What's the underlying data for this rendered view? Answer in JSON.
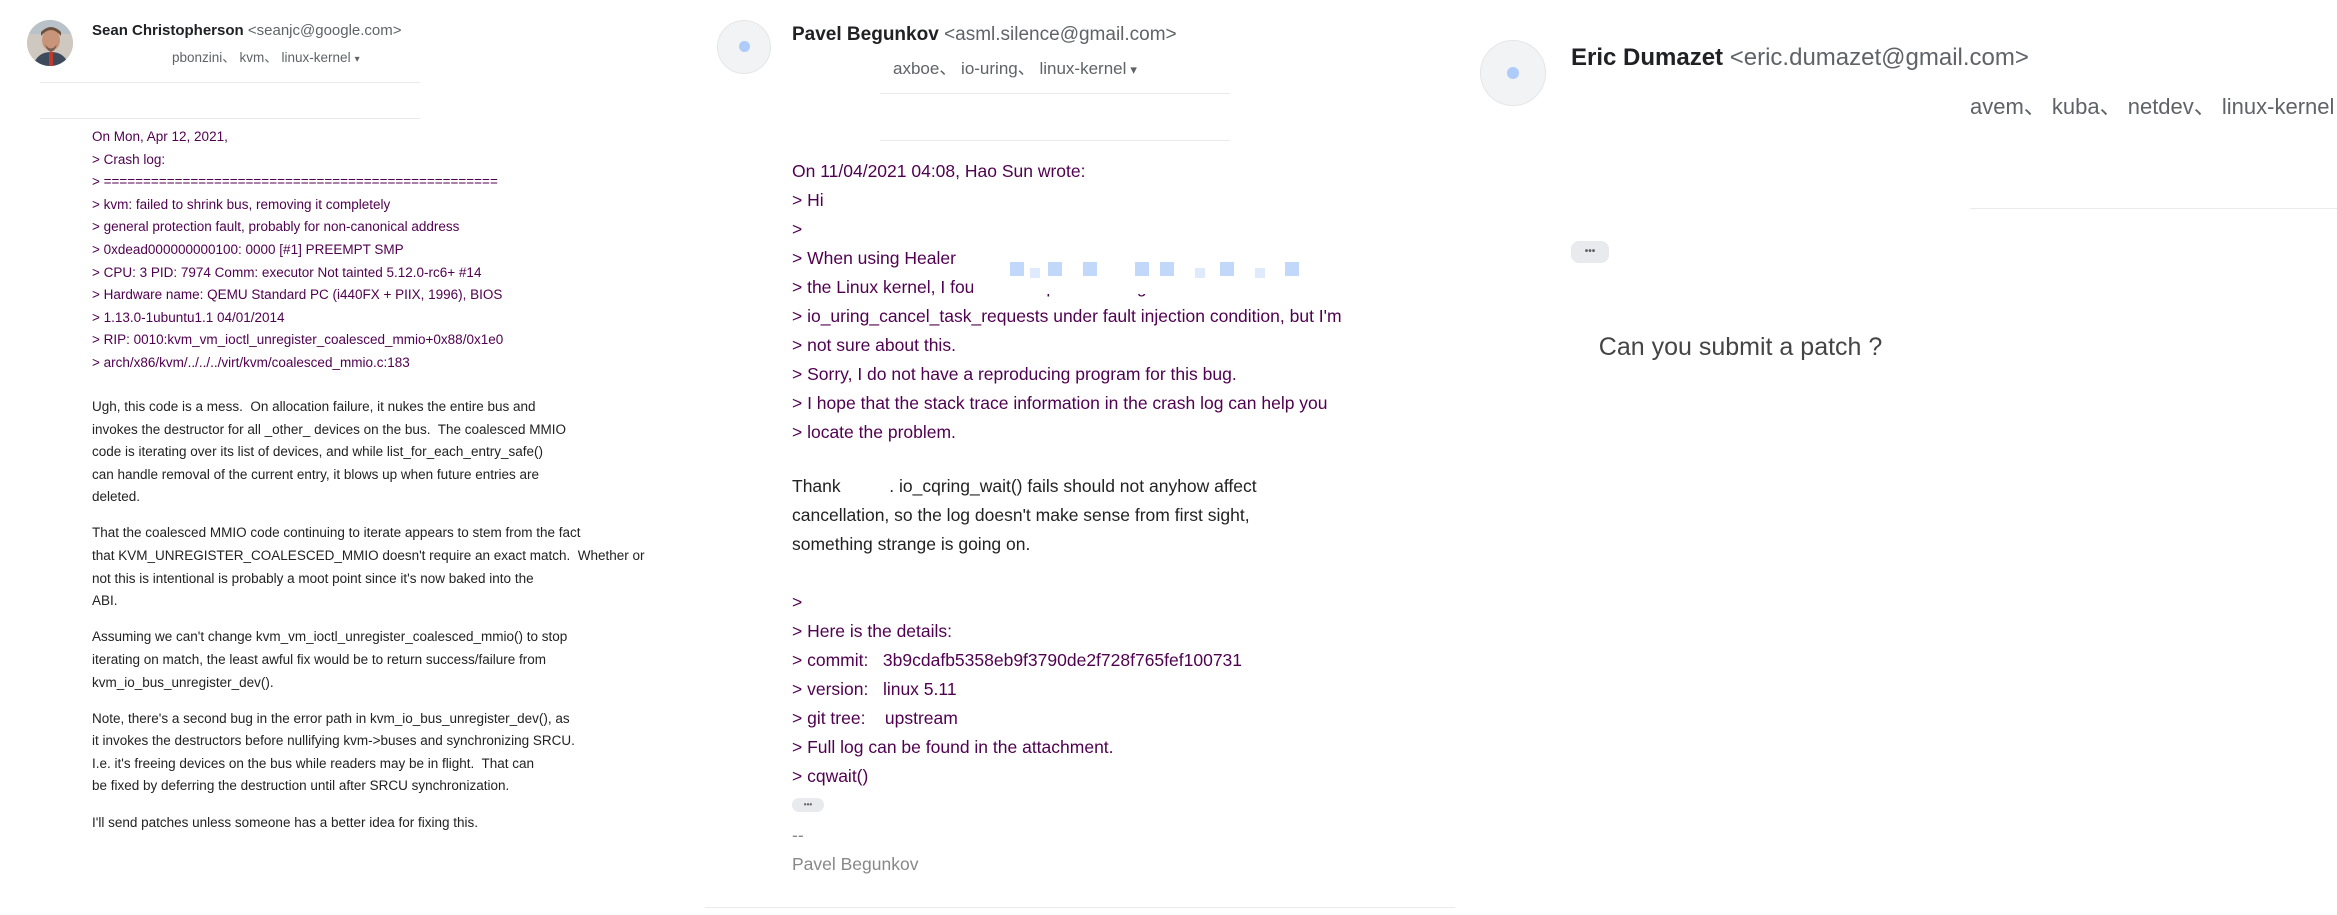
{
  "emails": [
    {
      "sender_name": "Sean Christopherson",
      "sender_email": "<seanjc@google.com>",
      "recipients": "pbonzini、 kvm、 linux-kernel",
      "recipients_caret": "▾",
      "avatar": "person-photo",
      "quoted_lines": [
        "On Mon, Apr 12, 2021,",
        "> Crash log:",
        "> ==================================================",
        "> kvm: failed to shrink bus, removing it completely",
        "> general protection fault, probably for non-canonical address",
        "> 0xdead000000000100: 0000 [#1] PREEMPT SMP",
        "> CPU: 3 PID: 7974 Comm: executor Not tainted 5.12.0-rc6+ #14",
        "> Hardware name: QEMU Standard PC (i440FX + PIIX, 1996), BIOS",
        "> 1.13.0-1ubuntu1.1 04/01/2014",
        "> RIP: 0010:kvm_vm_ioctl_unregister_coalesced_mmio+0x88/0x1e0",
        "> arch/x86/kvm/../../../virt/kvm/coalesced_mmio.c:183"
      ],
      "body_lines": [
        "Ugh, this code is a mess.  On allocation failure, it nukes the entire bus and",
        "invokes the destructor for all _other_ devices on the bus.  The coalesced MMIO",
        "code is iterating over its list of devices, and while list_for_each_entry_safe()",
        "can handle removal of the current entry, it blows up when future entries are",
        "deleted.",
        "",
        "That the coalesced MMIO code continuing to iterate appears to stem from the fact",
        "that KVM_UNREGISTER_COALESCED_MMIO doesn't require an exact match.  Whether or",
        "not this is intentional is probably a moot point since it's now baked into the",
        "ABI.",
        "",
        "Assuming we can't change kvm_vm_ioctl_unregister_coalesced_mmio() to stop",
        "iterating on match, the least awful fix would be to return success/failure from",
        "kvm_io_bus_unregister_dev().",
        "",
        "Note, there's a second bug in the error path in kvm_io_bus_unregister_dev(), as",
        "it invokes the destructors before nullifying kvm->buses and synchronizing SRCU.",
        "I.e. it's freeing devices on the bus while readers may be in flight.  That can",
        "be fixed by deferring the destruction until after SRCU synchronization.",
        "",
        "I'll send patches unless someone has a better idea for fixing this."
      ]
    },
    {
      "sender_name": "Pavel Begunkov",
      "sender_email": "<asml.silence@gmail.com>",
      "recipients": "axboe、 io-uring、 linux-kernel",
      "recipients_caret": "▾",
      "avatar": "placeholder-avatar",
      "quoted_lines": [
        "On 11/04/2021 04:08, Hao Sun wrote:",
        "> Hi",
        ">",
        "> When using Healer                                                    ) to fuzz",
        "> the Linux kernel, I found a null-ptr-deref bug in",
        "> io_uring_cancel_task_requests under fault injection condition, but I'm",
        "> not sure about this.",
        "> Sorry, I do not have a reproducing program for this bug.",
        "> I hope that the stack trace information in the crash log can help you",
        "> locate the problem."
      ],
      "body_lines": [
        "Thank          . io_cqring_wait() fails should not anyhow affect",
        "cancellation, so the log doesn't make sense from first sight,",
        "something strange is going on."
      ],
      "quoted_lines_2": [
        ">",
        "> Here is the details:",
        "> commit:   3b9cdafb5358eb9f3790de2f728f765fef100731",
        "> version:   linux 5.11",
        "> git tree:    upstream",
        "> Full log can be found in the attachment.",
        "> cqwait()"
      ],
      "ellipsis": "•••",
      "signature_lines": [
        "--",
        "Pavel Begunkov"
      ]
    },
    {
      "sender_name": "Eric Dumazet",
      "sender_email": "<eric.dumazet@gmail.com>",
      "recipients": "avem、 kuba、 netdev、 linux-kernel",
      "recipients_caret": "▾",
      "avatar": "placeholder-avatar",
      "ellipsis": "•••",
      "body_lines": [
        "Can you submit a patch ?"
      ]
    }
  ],
  "colors": {
    "quoted": "#500050",
    "body": "#222222",
    "sender": "#202124",
    "meta": "#5f6368",
    "signature": "#888888",
    "avatar_accent": "#aecbfa"
  }
}
